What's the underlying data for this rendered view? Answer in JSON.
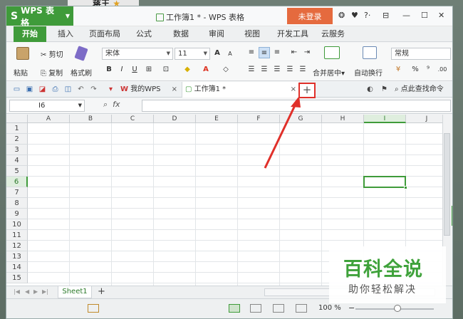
{
  "desktop": {
    "name_text": "蒋王",
    "star": "★"
  },
  "titlebar": {
    "app_menu": "WPS 表格",
    "app_logo": "S",
    "doc_title": "工作簿1 * - WPS 表格",
    "login": "未登录",
    "icons": [
      "skin-icon",
      "theme-icon",
      "help-icon",
      "menu-icon",
      "minimize-icon",
      "maximize-icon",
      "close-icon"
    ]
  },
  "ribbon_tabs": [
    "开始",
    "插入",
    "页面布局",
    "公式",
    "数据",
    "审阅",
    "视图",
    "开发工具",
    "云服务"
  ],
  "ribbon": {
    "paste": "粘贴",
    "cut": "剪切",
    "copy": "复制",
    "format_painter": "格式刷",
    "font_name": "宋体",
    "font_size": "11",
    "merge_center": "合并居中",
    "wrap_text": "自动换行",
    "number_format": "常规",
    "bold": "B",
    "italic": "I",
    "underline": "U",
    "grow": "A",
    "shrink": "A",
    "percent": "%",
    "comma": "⁹",
    "decimal": ".00"
  },
  "quick_toolbar": {
    "my_wps_tab": "我的WPS",
    "book_tab": "工作簿1 *",
    "close_glyph": "×",
    "new_tab": "+",
    "search_command": "点此查找命令"
  },
  "formula_bar": {
    "cell_ref": "I6",
    "fx": "fx",
    "value": ""
  },
  "grid": {
    "columns": [
      "A",
      "B",
      "C",
      "D",
      "E",
      "F",
      "G",
      "H",
      "I",
      "J"
    ],
    "rows": [
      "1",
      "2",
      "3",
      "4",
      "5",
      "6",
      "7",
      "8",
      "9",
      "10",
      "11",
      "12",
      "13",
      "14",
      "15"
    ],
    "selected_col": "I",
    "selected_row": "6"
  },
  "sheets": {
    "tabs": [
      "Sheet1"
    ],
    "add": "+"
  },
  "status": {
    "zoom": "100 %",
    "zoom_minus": "−"
  },
  "watermark": {
    "line1": "百科全说",
    "line2": "助你轻松解决"
  },
  "colors": {
    "accent": "#3f9b3a",
    "login": "#e56a3e",
    "annotation": "#e0302a"
  }
}
